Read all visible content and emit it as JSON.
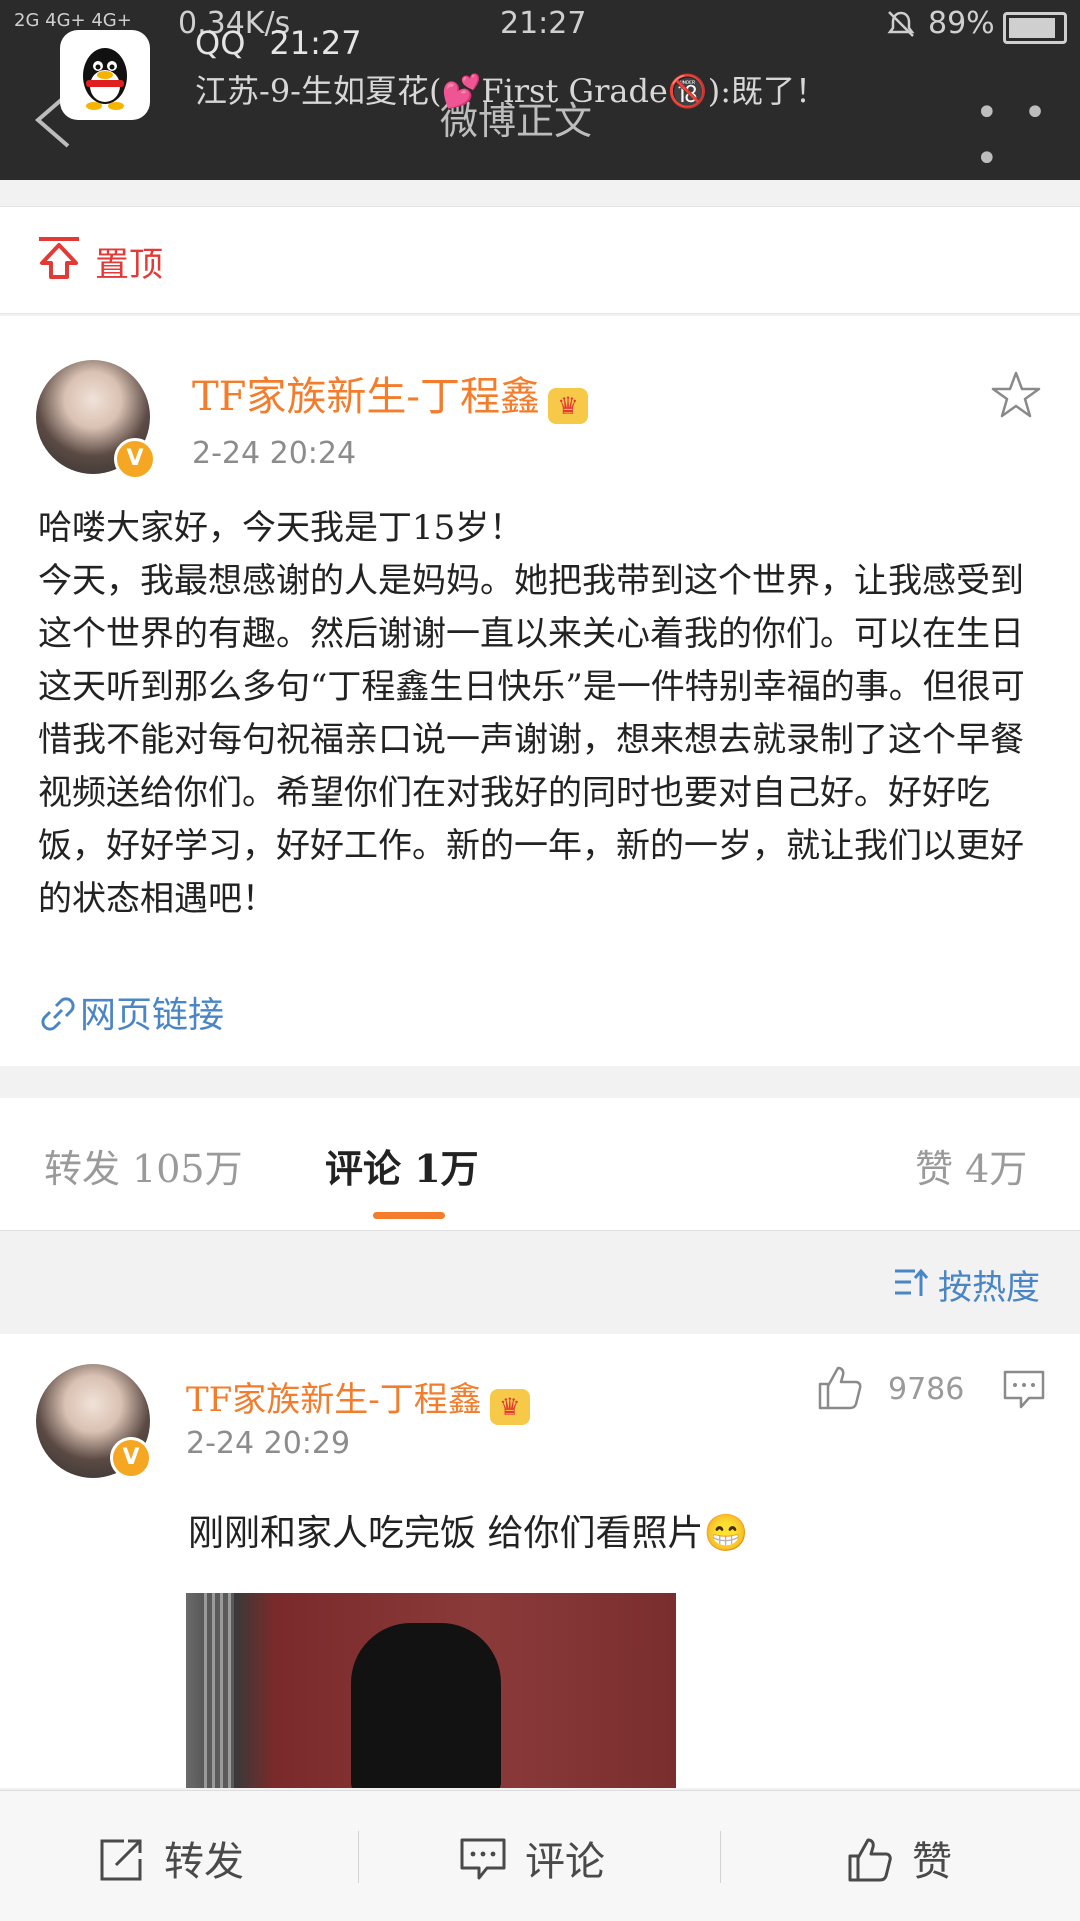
{
  "status_bar": {
    "network": "2G 4G+ 4G+",
    "speed": "0.34K/s",
    "time": "21:27",
    "battery": "89%"
  },
  "notification": {
    "app": "QQ",
    "time": "21:27",
    "message": "江苏-9-生如夏花(💕First Grade🔞):既了！"
  },
  "header": {
    "title": "微博正文"
  },
  "pinned": {
    "label": "置顶"
  },
  "post": {
    "author": "TF家族新生-丁程鑫",
    "time": "2-24 20:24",
    "text": "哈喽大家好，今天我是丁15岁！\n今天，我最想感谢的人是妈妈。她把我带到这个世界，让我感受到这个世界的有趣。然后谢谢一直以来关心着我的你们。可以在生日这天听到那么多句“丁程鑫生日快乐”是一件特别幸福的事。但很可惜我不能对每句祝福亲口说一声谢谢，想来想去就录制了这个早餐视频送给你们。希望你们在对我好的同时也要对自己好。好好吃饭，好好学习，好好工作。新的一年，新的一岁，就让我们以更好的状态相遇吧！",
    "link_label": "网页链接",
    "verified_mark": "V"
  },
  "tabs": {
    "repost": "转发 105万",
    "comment": "评论 1万",
    "like": "赞 4万"
  },
  "sort": {
    "label": "按热度"
  },
  "comment": {
    "author": "TF家族新生-丁程鑫",
    "time": "2-24 20:29",
    "likes": "9786",
    "text": "刚刚和家人吃完饭 给你们看照片😁"
  },
  "bottom_bar": {
    "repost": "转发",
    "comment": "评论",
    "like": "赞"
  },
  "colors": {
    "accent": "#f47c2a",
    "link": "#4a86c5",
    "pinned": "#e53935",
    "header_bg": "#2b2b2b"
  }
}
